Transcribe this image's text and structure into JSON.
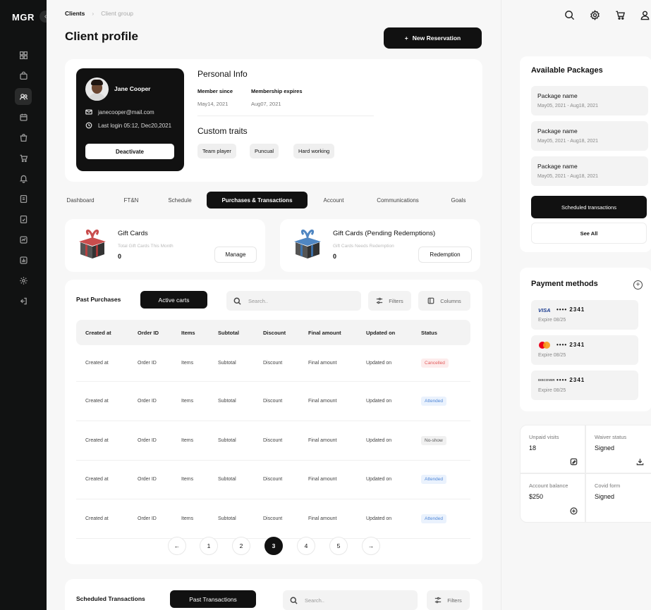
{
  "app": {
    "logo": "MGR"
  },
  "breadcrumb": {
    "current": "Clients",
    "next": "Client group"
  },
  "page": {
    "title": "Client profile",
    "new_reservation": "New Reservation"
  },
  "profile": {
    "name": "Jane Cooper",
    "email": "janecooper@mail.com",
    "last_login": "Last login  05:12, Dec20,2021",
    "deactivate": "Deactivate"
  },
  "personal_info": {
    "title": "Personal Info",
    "member_since_label": "Member since",
    "member_since": "May14, 2021",
    "membership_expires_label": "Membership expires",
    "membership_expires": "Aug07, 2021"
  },
  "traits": {
    "title": "Custom traits",
    "items": [
      "Team player",
      "Puncual",
      "Hard working"
    ]
  },
  "tabs": [
    "Dashboard",
    "FT&N",
    "Schedule",
    "Purchases & Transactions",
    "Account",
    "Communications",
    "Goals"
  ],
  "gift_cards": {
    "title": "Gift Cards",
    "sub": "Total Gift Cards This Month",
    "value": "0",
    "button": "Manage"
  },
  "gift_pending": {
    "title": "Gift Cards (Pending Redemptions)",
    "sub": "Gift Cards Needs Redemption",
    "value": "0",
    "button": "Redemption"
  },
  "purchases": {
    "title": "Past Purchases",
    "active_carts": "Active carts",
    "search_placeholder": "Search..",
    "filters": "Filters",
    "columns": "Columns",
    "headers": [
      "Created at",
      "Order ID",
      "Items",
      "Subtotal",
      "Discount",
      "Final amount",
      "Updated on",
      "Status"
    ],
    "rows": [
      {
        "created": "Created at",
        "order": "Order ID",
        "items": "Items",
        "subtotal": "Subtotal",
        "discount": "Discount",
        "final": "Final amount",
        "updated": "Updated on",
        "status": "Cancelled"
      },
      {
        "created": "Created at",
        "order": "Order ID",
        "items": "Items",
        "subtotal": "Subtotal",
        "discount": "Discount",
        "final": "Final amount",
        "updated": "Updated on",
        "status": "Attended"
      },
      {
        "created": "Created at",
        "order": "Order ID",
        "items": "Items",
        "subtotal": "Subtotal",
        "discount": "Discount",
        "final": "Final amount",
        "updated": "Updated on",
        "status": "No-show"
      },
      {
        "created": "Created at",
        "order": "Order ID",
        "items": "Items",
        "subtotal": "Subtotal",
        "discount": "Discount",
        "final": "Final amount",
        "updated": "Updated on",
        "status": "Attended"
      },
      {
        "created": "Created at",
        "order": "Order ID",
        "items": "Items",
        "subtotal": "Subtotal",
        "discount": "Discount",
        "final": "Final amount",
        "updated": "Updated on",
        "status": "Attended"
      }
    ],
    "pages": [
      "1",
      "2",
      "3",
      "4",
      "5"
    ],
    "current_page": "3"
  },
  "scheduled": {
    "title": "Scheduled Transactions",
    "past": "Past Transactions",
    "search_placeholder": "Search..",
    "filters": "Filters"
  },
  "packages": {
    "title": "Available Packages",
    "items": [
      {
        "name": "Package name",
        "dates": "May05, 2021 - Aug18, 2021"
      },
      {
        "name": "Package name",
        "dates": "May05, 2021 - Aug18, 2021"
      },
      {
        "name": "Package name",
        "dates": "May05, 2021 - Aug18, 2021"
      }
    ],
    "scheduled_btn": "Scheduled transactions",
    "see_all": "See All"
  },
  "payment": {
    "title": "Payment methods",
    "cards": [
      {
        "brand": "VISA",
        "number": "•••• 2341",
        "expire": "Expire 08/25"
      },
      {
        "brand": "mastercard",
        "number": "•••• 2341",
        "expire": "Expire 08/25"
      },
      {
        "brand": "DISCOVER",
        "number": "•••• 2341",
        "expire": "Expire 08/25"
      }
    ]
  },
  "stats": {
    "unpaid_label": "Unpaid visits",
    "unpaid": "18",
    "waiver_label": "Waiver status",
    "waiver": "Signed",
    "balance_label": "Account balance",
    "balance": "$250",
    "covid_label": "Covid form",
    "covid": "Signed"
  },
  "colors": {
    "dark": "#111111",
    "cancelled": "#e25b5b",
    "attended": "#4f86d6"
  }
}
